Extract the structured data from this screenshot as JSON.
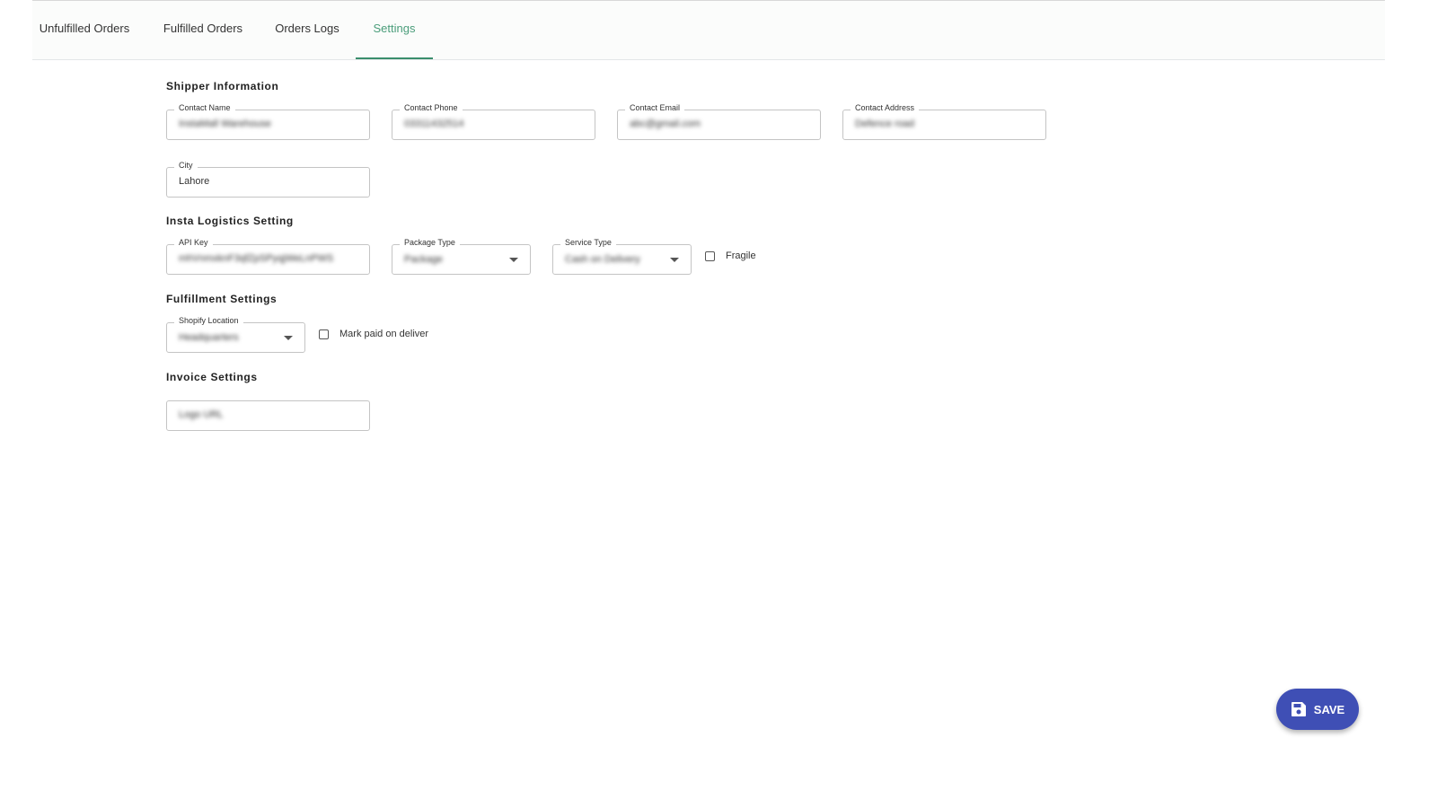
{
  "tabs": [
    {
      "label": "Unfulfilled Orders"
    },
    {
      "label": "Fulfilled Orders"
    },
    {
      "label": "Orders Logs"
    },
    {
      "label": "Settings",
      "active": true
    }
  ],
  "sections": {
    "shipper": "Shipper Information",
    "logistics": "Insta Logistics Setting",
    "fulfillment": "Fulfillment Settings",
    "invoice": "Invoice Settings"
  },
  "fields": {
    "contact_name": {
      "label": "Contact Name",
      "value": "InstaMall Warehouse"
    },
    "contact_phone": {
      "label": "Contact Phone",
      "value": "03311432514"
    },
    "contact_email": {
      "label": "Contact Email",
      "value": "abc@gmail.com"
    },
    "contact_address": {
      "label": "Contact Address",
      "value": "Defence road"
    },
    "city": {
      "label": "City",
      "value": "Lahore"
    },
    "api_key": {
      "label": "API Key",
      "value": "mhVnmxknF3qfZpSPyqjWeLnPWS"
    },
    "package_type": {
      "label": "Package Type",
      "value": "Package"
    },
    "service_type": {
      "label": "Service Type",
      "value": "Cash on Delivery"
    },
    "shopify_location": {
      "label": "Shopify Location",
      "value": "Headquarters"
    },
    "logo_url": {
      "placeholder": "Logo URL"
    }
  },
  "checkboxes": {
    "fragile": {
      "label": "Fragile",
      "checked": false
    },
    "mark_paid": {
      "label": "Mark paid on deliver",
      "checked": false
    }
  },
  "save_label": "SAVE",
  "colors": {
    "accent": "#3a8e6c",
    "save": "#3f4fb5"
  }
}
